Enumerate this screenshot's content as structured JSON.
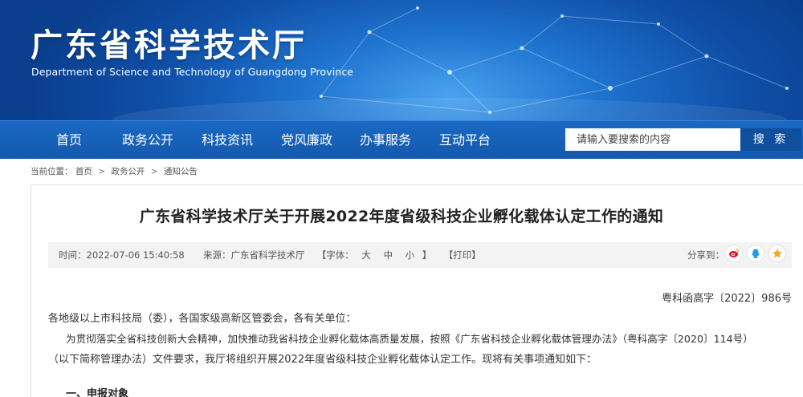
{
  "site": {
    "title": "广东省科学技术厅",
    "subtitle": "Department of Science and Technology of Guangdong Province"
  },
  "nav": {
    "items": [
      "首页",
      "政务公开",
      "科技资讯",
      "党风廉政",
      "办事服务",
      "互动平台"
    ],
    "search_placeholder": "请输入要搜索的内容",
    "search_label": "搜 索"
  },
  "breadcrumb": {
    "prefix": "当前位置：",
    "items": [
      "首页",
      "政务公开",
      "通知公告"
    ],
    "separator": ">"
  },
  "article": {
    "title": "广东省科学技术厅关于开展2022年度省级科技企业孵化载体认定工作的通知",
    "time": "时间：2022-07-06 15:40:58",
    "source": "来源：广东省科学技术厅",
    "font_size_label": "【字体：",
    "font_large": "大",
    "font_medium": "中",
    "font_small": "小",
    "font_size_close": "】",
    "print": "【打印】",
    "share_label": "分享到：",
    "share_icons": [
      "weibo-icon",
      "qq-icon",
      "qzone-icon"
    ],
    "doc_number": "粤科函高字〔2022〕986号",
    "salutation": "各地级以上市科技局（委），各国家级高新区管委会，各有关单位：",
    "para1_line1": "为贯彻落实全省科技创新大会精神，加快推动我省科技企业孵化载体高质量发展，按照《广东省科技企业孵化载体管理办法》（粤科高字〔2020〕114号）",
    "para1_line2": "（以下简称管理办法）文件要求，我厅将组织开展2022年度省级科技企业孵化载体认定工作。现将有关事项通知如下：",
    "section1": "一、申报对象"
  },
  "colors": {
    "banner_dark": "#0a3f8e",
    "nav_blue": "#1a69c4",
    "search_button": "#0f4f9e",
    "weibo": "#e6162d",
    "qq": "#1f9ee6",
    "qzone": "#f5a623"
  }
}
